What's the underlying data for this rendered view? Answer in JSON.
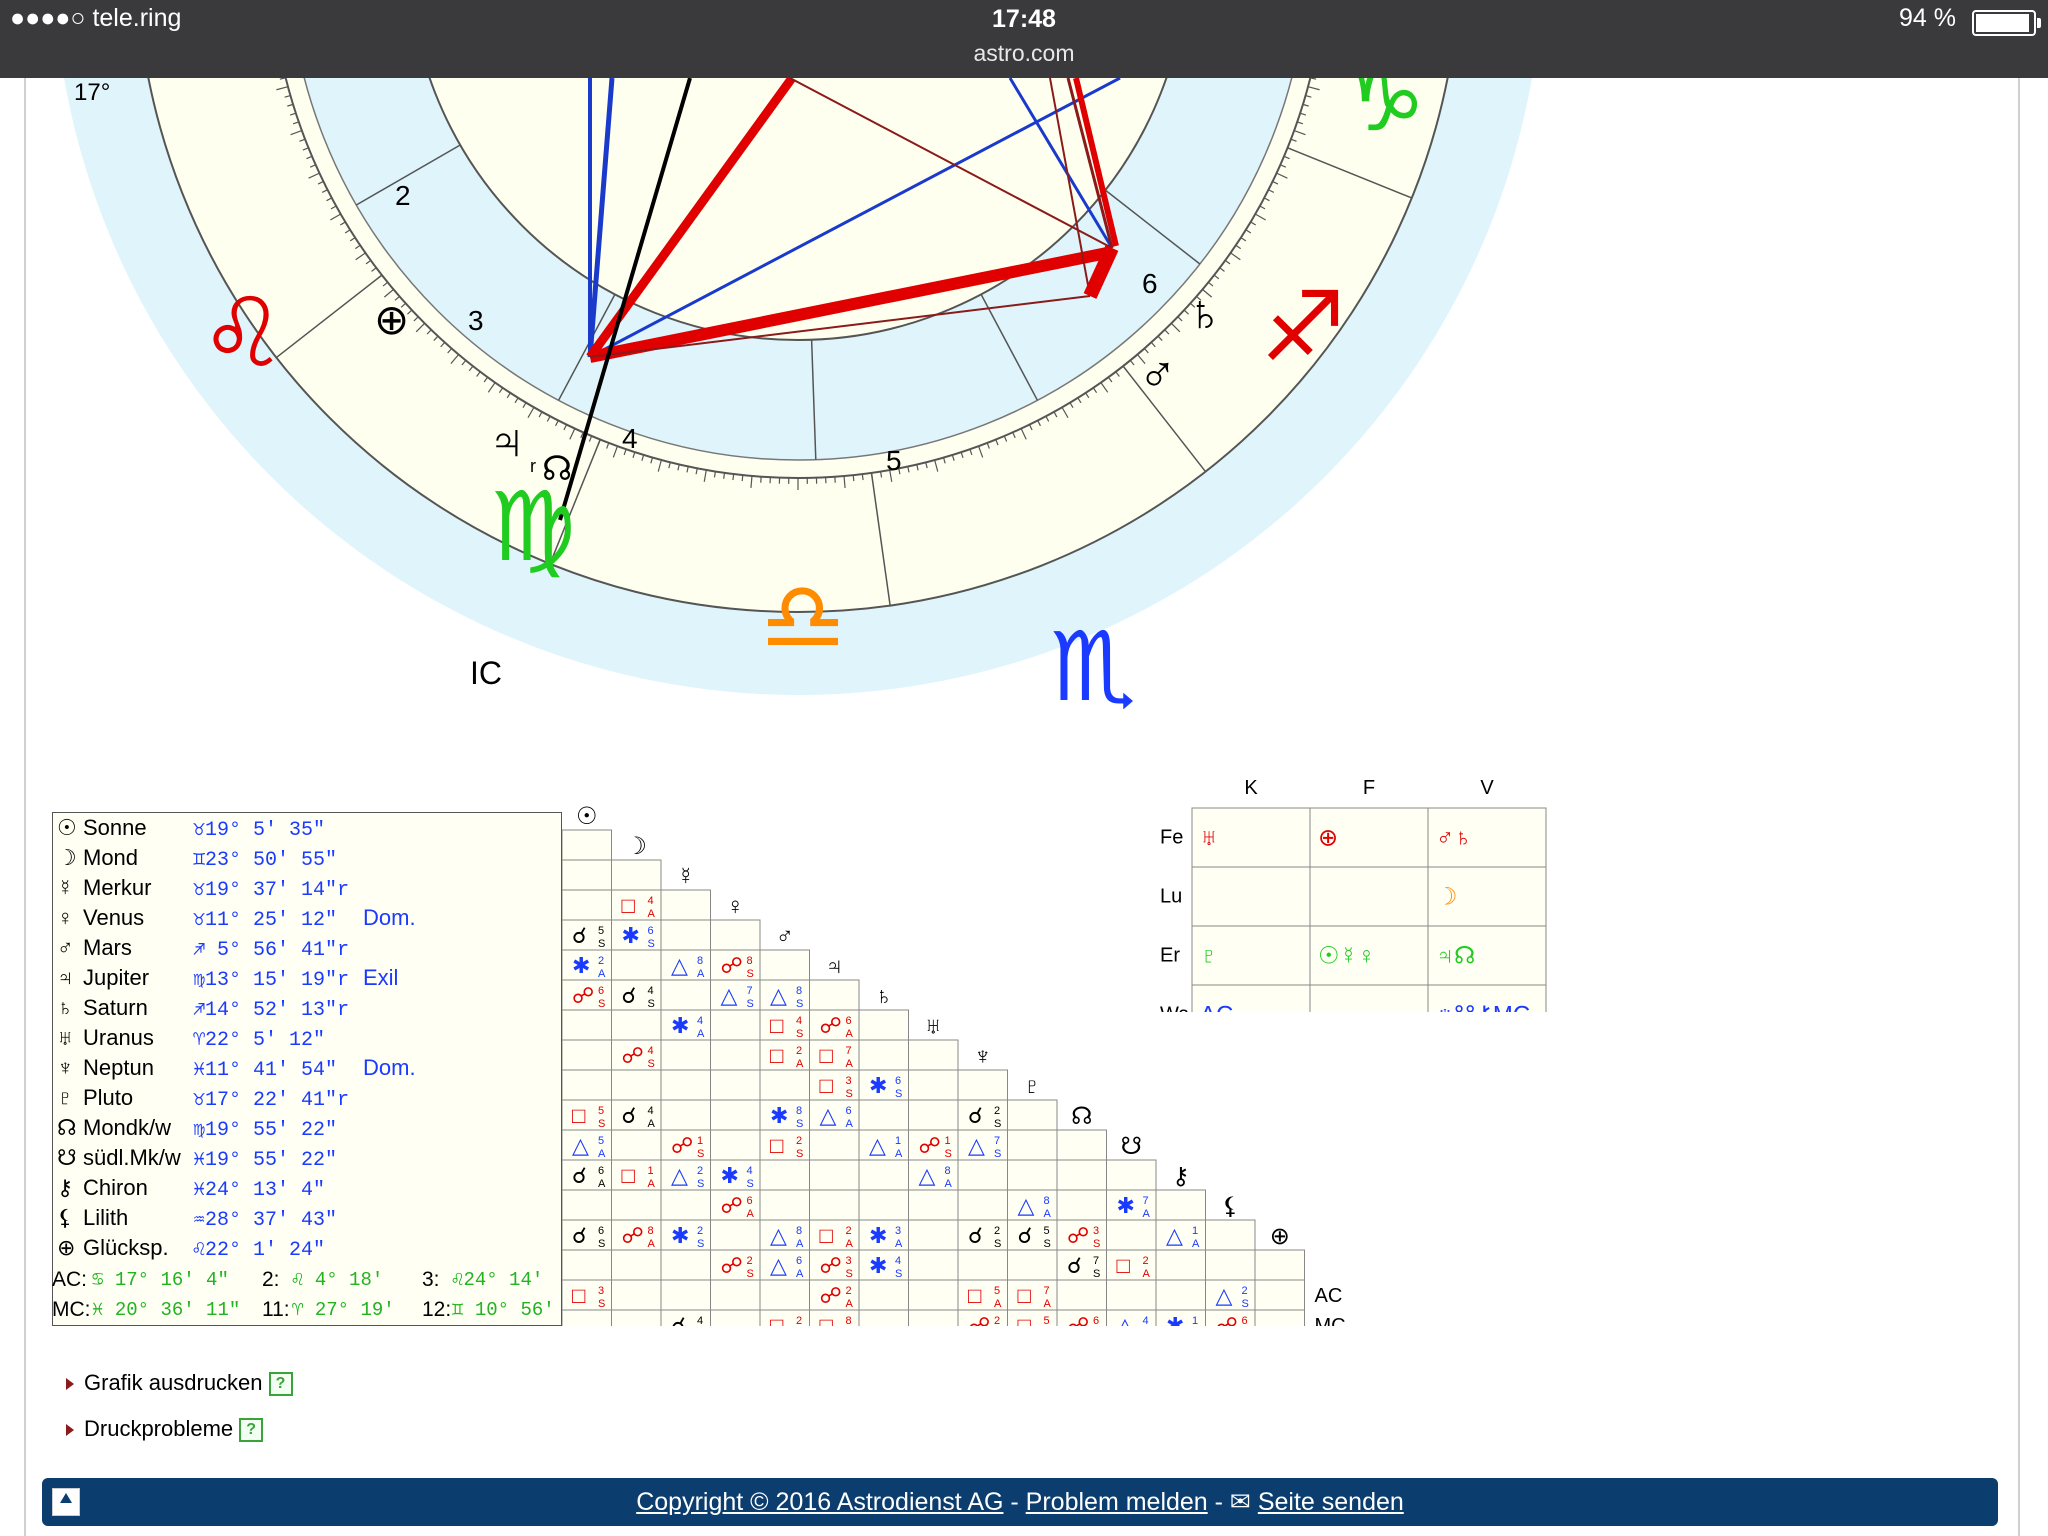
{
  "status": {
    "carrier": "●●●●○ tele.ring",
    "time": "17:48",
    "url": "astro.com",
    "battery": "94 %",
    "battery_level": 0.94
  },
  "wheel": {
    "houses": [
      "2",
      "3",
      "4",
      "5",
      "6"
    ],
    "degree_label": "17°",
    "ic_label": "IC",
    "signs": [
      {
        "name": "leo",
        "glyph": "♌",
        "color": "#e00000"
      },
      {
        "name": "virgo",
        "glyph": "♍",
        "color": "#1fcc1f"
      },
      {
        "name": "libra",
        "glyph": "♎",
        "color": "#ff8c00"
      },
      {
        "name": "scorpio",
        "glyph": "♏",
        "color": "#1a3aff"
      },
      {
        "name": "sagittarius",
        "glyph": "♐",
        "color": "#e00000"
      },
      {
        "name": "capricorn",
        "glyph": "♑",
        "color": "#1fcc1f"
      }
    ],
    "planet_glyphs": {
      "fortune": "⊕",
      "jupiter": "♃",
      "node": "☊",
      "saturn": "♄",
      "mars": "♂",
      "retro": "r"
    }
  },
  "planets": [
    {
      "sym": "☉",
      "name": "Sonne",
      "pos": "♉19°  5' 35\"",
      "flag": ""
    },
    {
      "sym": "☽",
      "name": "Mond",
      "pos": "♊23° 50' 55\"",
      "flag": ""
    },
    {
      "sym": "☿",
      "name": "Merkur",
      "pos": "♉19° 37' 14\"r",
      "flag": ""
    },
    {
      "sym": "♀",
      "name": "Venus",
      "pos": "♉11° 25' 12\"",
      "flag": "Dom."
    },
    {
      "sym": "♂",
      "name": "Mars",
      "pos": "♐ 5° 56' 41\"r",
      "flag": ""
    },
    {
      "sym": "♃",
      "name": "Jupiter",
      "pos": "♍13° 15' 19\"r",
      "flag": "Exil"
    },
    {
      "sym": "♄",
      "name": "Saturn",
      "pos": "♐14° 52' 13\"r",
      "flag": ""
    },
    {
      "sym": "♅",
      "name": "Uranus",
      "pos": "♈22°  5' 12\"",
      "flag": ""
    },
    {
      "sym": "♆",
      "name": "Neptun",
      "pos": "♓11° 41' 54\"",
      "flag": "Dom."
    },
    {
      "sym": "♇",
      "name": "Pluto",
      "pos": "♉17° 22' 41\"r",
      "flag": ""
    },
    {
      "sym": "☊",
      "name": "Mondk/w",
      "pos": "♍19° 55' 22\"",
      "flag": ""
    },
    {
      "sym": "☋",
      "name": "südl.Mk/w",
      "pos": "♓19° 55' 22\"",
      "flag": ""
    },
    {
      "sym": "⚷",
      "name": "Chiron",
      "pos": "♓24° 13'  4\"",
      "flag": ""
    },
    {
      "sym": "⚸",
      "name": "Lilith",
      "pos": "♒28° 37' 43\"",
      "flag": ""
    },
    {
      "sym": "⊕",
      "name": "Glücksp.",
      "pos": "♌22°  1' 24\"",
      "flag": ""
    }
  ],
  "houses_rows": [
    {
      "lbl": "AC:",
      "val": " ♋ 17° 16'  4\"",
      "h2l": "2:",
      "h2v": " ♌  4° 18'",
      "h3l": "3:",
      "h3v": " ♌24° 14'"
    },
    {
      "lbl": "MC:",
      "val": " ♓ 20° 36' 11\"",
      "h2l": "11:",
      "h2v": " ♈ 27° 19'",
      "h3l": "12:",
      "h3v": " ♊ 10° 56'"
    }
  ],
  "aspect_headers": [
    "☉",
    "☽",
    "☿",
    "♀",
    "♂",
    "♃",
    "♄",
    "♅",
    "♆",
    "♇",
    "☊",
    "☋",
    "⚷",
    "⚸",
    "⊕"
  ],
  "aspect_right_labels": [
    "AC",
    "MC"
  ],
  "elements": {
    "col_headers": [
      "K",
      "F",
      "V"
    ],
    "row_labels": [
      "Fe",
      "Lu",
      "Er",
      "Wa"
    ],
    "cells": [
      [
        {
          "t": "♅",
          "c": "#e00000"
        },
        {
          "t": "⊕",
          "c": "#e00000"
        },
        {
          "t": "♂♄",
          "c": "#e00000"
        }
      ],
      [
        {
          "t": "",
          "c": "#000"
        },
        {
          "t": "",
          "c": "#000"
        },
        {
          "t": "☽",
          "c": "#ff8c00"
        }
      ],
      [
        {
          "t": "♇",
          "c": "#1fcc1f"
        },
        {
          "t": "☉☿♀",
          "c": "#1fcc1f"
        },
        {
          "t": "♃☊",
          "c": "#1fcc1f"
        }
      ],
      [
        {
          "t": "AC",
          "c": "#1a3aff"
        },
        {
          "t": "",
          "c": "#000"
        },
        {
          "t": "♆☋⚷MC",
          "c": "#1a3aff"
        }
      ]
    ]
  },
  "links": [
    {
      "label": "Grafik ausdrucken",
      "help": "?"
    },
    {
      "label": "Druckprobleme",
      "help": "?"
    }
  ],
  "footer": {
    "copyright": "Copyright © 2016 Astrodienst AG",
    "sep1": " - ",
    "problem": "Problem melden",
    "sep2": " - ✉ ",
    "send": "Seite senden"
  }
}
